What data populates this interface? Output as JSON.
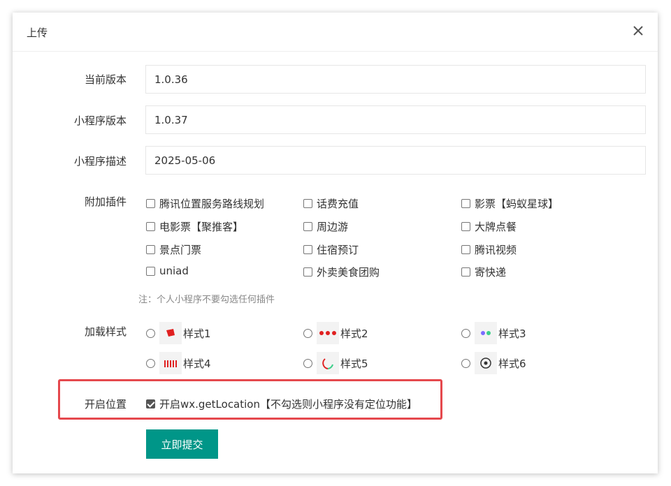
{
  "dialog": {
    "title": "上传"
  },
  "form": {
    "current_version": {
      "label": "当前版本",
      "value": "1.0.36"
    },
    "mini_version": {
      "label": "小程序版本",
      "value": "1.0.37"
    },
    "mini_desc": {
      "label": "小程序描述",
      "value": "2025-05-06"
    },
    "plugins": {
      "label": "附加插件",
      "items": [
        "腾讯位置服务路线规划",
        "话费充值",
        "影票【蚂蚁星球】",
        "电影票【聚推客】",
        "周边游",
        "大牌点餐",
        "景点门票",
        "住宿预订",
        "腾讯视频",
        "uniad",
        "外卖美食团购",
        "寄快递"
      ],
      "note": "注：个人小程序不要勾选任何插件"
    },
    "loading_style": {
      "label": "加载样式",
      "options": [
        "样式1",
        "样式2",
        "样式3",
        "样式4",
        "样式5",
        "样式6"
      ]
    },
    "location": {
      "label": "开启位置",
      "checkbox_label": "开启wx.getLocation【不勾选则小程序没有定位功能】",
      "checked": true
    },
    "submit_label": "立即提交"
  },
  "colors": {
    "primary": "#009688",
    "highlight": "#e5484d"
  }
}
